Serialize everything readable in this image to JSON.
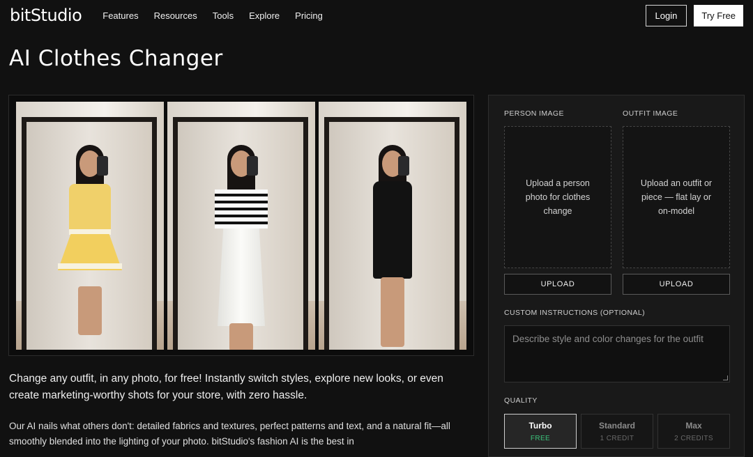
{
  "nav": {
    "logo": "bitStudio",
    "links": [
      "Features",
      "Resources",
      "Tools",
      "Explore",
      "Pricing"
    ],
    "login": "Login",
    "try_free": "Try Free"
  },
  "page_title": "AI Clothes Changer",
  "intro": "Change any outfit, in any photo, for free! Instantly switch styles, explore new looks, or even create marketing-worthy shots for your store, with zero hassle.",
  "body_text": "Our AI nails what others don't: detailed fabrics and textures, perfect patterns and text, and a natural fit—all smoothly blended into the lighting of your photo. bitStudio's fashion AI is the best in",
  "panel": {
    "person_label": "PERSON IMAGE",
    "outfit_label": "OUTFIT IMAGE",
    "person_drop": "Upload a person photo for clothes change",
    "outfit_drop": "Upload an outfit or piece — flat lay or on-model",
    "upload": "UPLOAD",
    "custom_label": "CUSTOM INSTRUCTIONS (OPTIONAL)",
    "custom_placeholder": "Describe style and color changes for the outfit",
    "quality_label": "QUALITY",
    "quality": [
      {
        "name": "Turbo",
        "cost": "FREE"
      },
      {
        "name": "Standard",
        "cost": "1 CREDIT"
      },
      {
        "name": "Max",
        "cost": "2 CREDITS"
      }
    ]
  },
  "colors": {
    "accent_free": "#3cc47c",
    "background": "#111111"
  }
}
